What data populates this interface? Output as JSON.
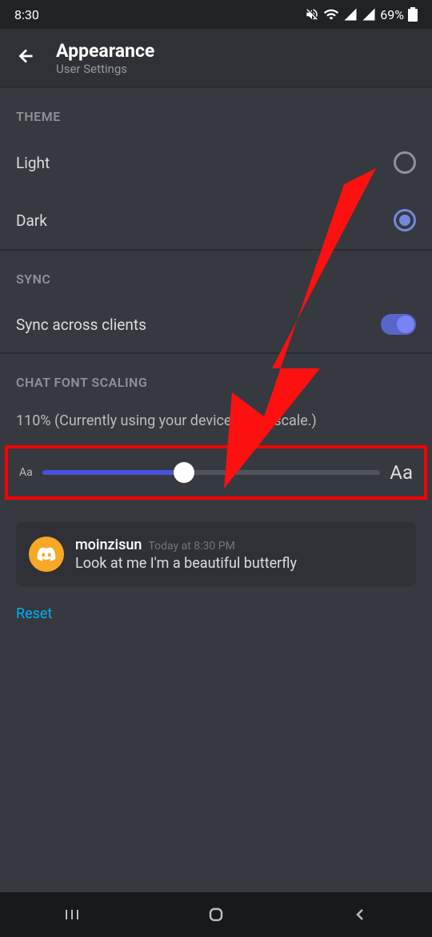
{
  "statusBar": {
    "time": "8:30",
    "battery": "69%"
  },
  "header": {
    "title": "Appearance",
    "subtitle": "User Settings"
  },
  "sections": {
    "theme": {
      "label": "THEME",
      "options": {
        "light": "Light",
        "dark": "Dark"
      }
    },
    "sync": {
      "label": "SYNC",
      "option": "Sync across clients"
    },
    "fontScaling": {
      "label": "CHAT FONT SCALING",
      "value": "110% (Currently using your device's font scale.)",
      "sliderSmall": "Aa",
      "sliderLarge": "Aa"
    }
  },
  "preview": {
    "username": "moinzisun",
    "timestamp": "Today at 8:30 PM",
    "message": "Look at me I'm a beautiful butterfly"
  },
  "reset": "Reset"
}
